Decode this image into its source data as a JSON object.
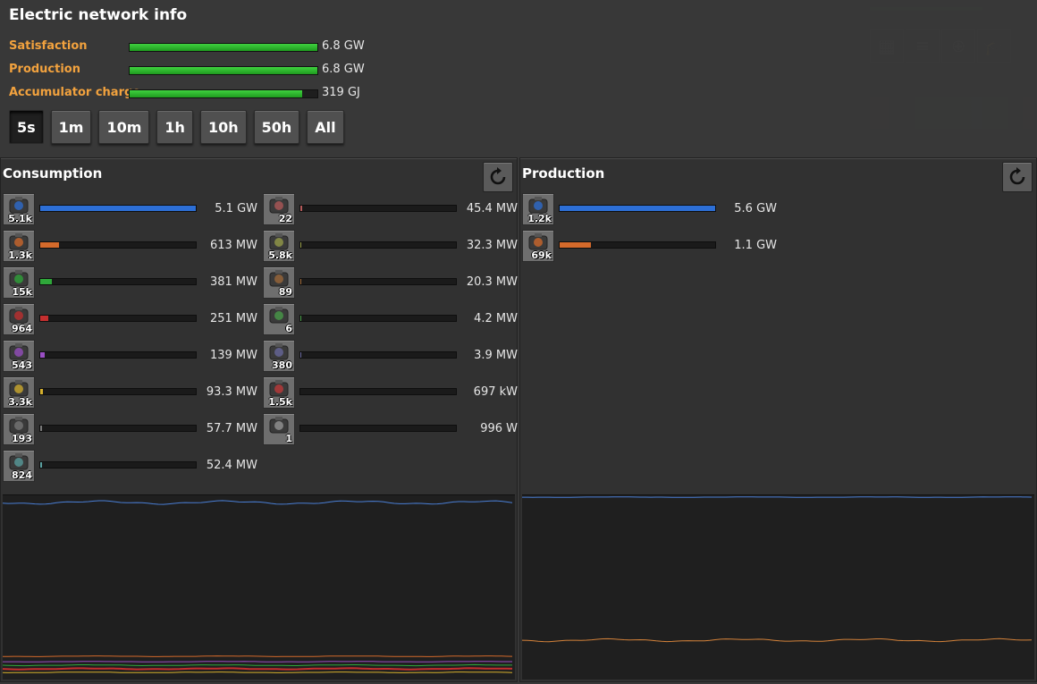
{
  "window": {
    "title": "Electric network info"
  },
  "stats": [
    {
      "label": "Satisfaction",
      "value": "6.8 GW",
      "fill": 1.0
    },
    {
      "label": "Production",
      "value": "6.8 GW",
      "fill": 1.0
    },
    {
      "label": "Accumulator charge",
      "value": "319 GJ",
      "fill": 0.92
    }
  ],
  "time_buttons": [
    "5s",
    "1m",
    "10m",
    "1h",
    "10h",
    "50h",
    "All"
  ],
  "active_time": "5s",
  "consumption": {
    "title": "Consumption",
    "items": [
      {
        "icon": "assembling-machine-icon",
        "count": "5.1k",
        "value": "5.1 GW",
        "fill": 1.0,
        "color": "#2d6fd6"
      },
      {
        "icon": "electric-mining-drill-icon",
        "count": "1.3k",
        "value": "613 MW",
        "fill": 0.12,
        "color": "#d46a2b"
      },
      {
        "icon": "inserter-icon",
        "count": "15k",
        "value": "381 MW",
        "fill": 0.075,
        "color": "#2fa83a"
      },
      {
        "icon": "electric-furnace-icon",
        "count": "964",
        "value": "251 MW",
        "fill": 0.05,
        "color": "#c42f2f"
      },
      {
        "icon": "beacon-icon",
        "count": "543",
        "value": "139 MW",
        "fill": 0.028,
        "color": "#9a4fc4"
      },
      {
        "icon": "oil-refinery-icon",
        "count": "3.3k",
        "value": "93.3 MW",
        "fill": 0.018,
        "color": "#d6b02d"
      },
      {
        "icon": "chemical-plant-icon",
        "count": "193",
        "value": "57.7 MW",
        "fill": 0.011,
        "color": "#7a7a7a"
      },
      {
        "icon": "pump-icon",
        "count": "824",
        "value": "52.4 MW",
        "fill": 0.01,
        "color": "#5aa0a0"
      },
      {
        "icon": "lab-icon",
        "count": "22",
        "value": "45.4 MW",
        "fill": 0.009,
        "color": "#b45a5a"
      },
      {
        "icon": "long-handed-inserter-icon",
        "count": "5.8k",
        "value": "32.3 MW",
        "fill": 0.006,
        "color": "#9aa04a"
      },
      {
        "icon": "roboport-icon",
        "count": "89",
        "value": "20.3 MW",
        "fill": 0.004,
        "color": "#a06a3a"
      },
      {
        "icon": "substation-icon",
        "count": "6",
        "value": "4.2 MW",
        "fill": 0.001,
        "color": "#4aa04a"
      },
      {
        "icon": "radar-icon",
        "count": "380",
        "value": "3.9 MW",
        "fill": 0.001,
        "color": "#6a6aa0"
      },
      {
        "icon": "fast-inserter-icon",
        "count": "1.5k",
        "value": "697 kW",
        "fill": 0.0,
        "color": "#c43a3a"
      },
      {
        "icon": "filter-inserter-icon",
        "count": "1",
        "value": "996 W",
        "fill": 0.0,
        "color": "#9a9a9a"
      }
    ]
  },
  "production": {
    "title": "Production",
    "items": [
      {
        "icon": "steam-turbine-icon",
        "count": "1.2k",
        "value": "5.6 GW",
        "fill": 1.0,
        "color": "#2d6fd6"
      },
      {
        "icon": "solar-panel-icon",
        "count": "69k",
        "value": "1.1 GW",
        "fill": 0.2,
        "color": "#d46a2b"
      }
    ]
  },
  "colors": {
    "label_orange": "#f2a23e",
    "satisfaction_green": "#3fd23f",
    "series_blue": "#4a7fd6",
    "series_orange": "#d4823a"
  }
}
